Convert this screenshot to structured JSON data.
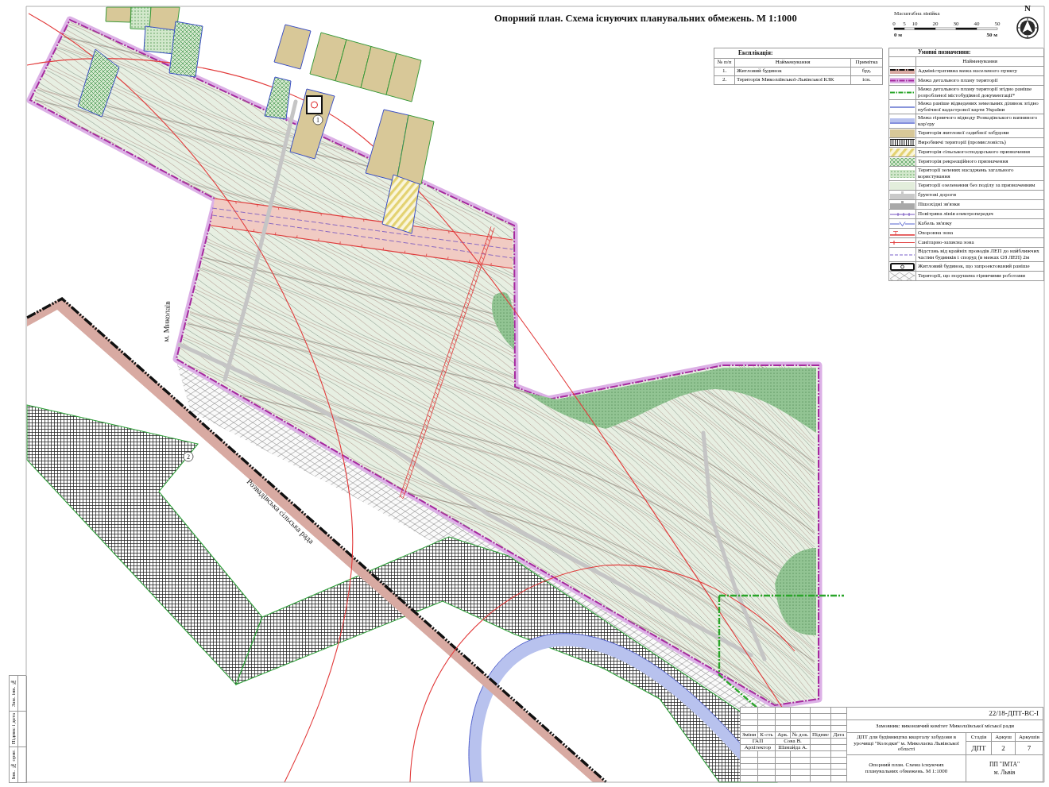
{
  "title": "Опорний план. Схема існуючих планувальних обмежень. М 1:1000",
  "scale_bar": {
    "label": "Масштабна лінійка",
    "ticks": [
      "0",
      "5",
      "10",
      "20",
      "30",
      "40",
      "50"
    ],
    "start_label": "0 м",
    "end_label": "50 м"
  },
  "compass": {
    "north": "N"
  },
  "explication": {
    "title": "Експлікація:",
    "columns": [
      "№ п/п",
      "Найменування",
      "Примітка"
    ],
    "rows": [
      {
        "number": "1.",
        "name": "Житловий будинок",
        "note": "буд."
      },
      {
        "number": "2.",
        "name": "Територія Миколаївської-Львівської КЗК",
        "note": "існ."
      }
    ]
  },
  "legend": {
    "title": "Умовні позначення:",
    "column": "Найменування",
    "items": [
      {
        "kind": "admin_boundary",
        "label": "Адміністративна межа населеного пункту"
      },
      {
        "kind": "plan_boundary",
        "label": "Межа детального плану території"
      },
      {
        "kind": "earlier_plan_boundary",
        "label": "Межа детального плану території згідно раніше розробленої містобудівної документації*"
      },
      {
        "kind": "land_plot_boundary",
        "label": "Межа раніше відведених земельних ділянок згідно публічної кадастрової карти України"
      },
      {
        "kind": "quarry_boundary",
        "label": "Межа гірничого відводу Розвадівського вапняного кар'єру"
      },
      {
        "kind": "residential",
        "label": "Територія житлової садибної забудови"
      },
      {
        "kind": "industrial",
        "label": "Виробничі території (промисловість)"
      },
      {
        "kind": "agricultural",
        "label": "Територія сільськогосподарського призначення"
      },
      {
        "kind": "recreation",
        "label": "Територія рекреаційного призначення"
      },
      {
        "kind": "public_greenery",
        "label": "Території зелених насаджень загального користування"
      },
      {
        "kind": "greenery",
        "label": "Території озеленення без поділу за призначенням"
      },
      {
        "kind": "dirt_road",
        "label": "Ґрунтові дороги"
      },
      {
        "kind": "footpath",
        "label": "Пішохідні зв'язки"
      },
      {
        "kind": "power_line",
        "label": "Повітряна лінія електропередач"
      },
      {
        "kind": "cable",
        "label": "Кабель зв'язку"
      },
      {
        "kind": "protection_zone",
        "label": "Охоронна зона"
      },
      {
        "kind": "sanitary_zone",
        "label": "Санітарно-захисна зона"
      },
      {
        "kind": "distance_line",
        "label": "Відстань від крайніх проводів ЛЕП до найближчих частин будинків і споруд (в межах ОЗ ЛЕП) 2м"
      },
      {
        "kind": "house",
        "label": "Житловий будинок, що запроектований раніше"
      },
      {
        "kind": "disturbed_land",
        "label": "Території, що порушена гірничими роботами"
      }
    ]
  },
  "map": {
    "place_labels": [
      {
        "kind": "town",
        "text": "м. Миколаїв"
      },
      {
        "kind": "council",
        "text": "Розвадівська сільська рада"
      }
    ],
    "markers": [
      "1",
      "2"
    ]
  },
  "title_block": {
    "code": "22/18-ДПТ-ВС-І",
    "customer": "Замовник: виконавчий комітет Миколаївської міської ради",
    "change_columns": [
      "Зміни",
      "К-сть",
      "Арк.",
      "№ док.",
      "Підпис",
      "Дата"
    ],
    "signatures": [
      {
        "role": "ГАП",
        "name": "Сова В."
      },
      {
        "role": "Архітектор",
        "name": "Шамайда А."
      }
    ],
    "project": "ДПТ для будівництва кварталу забудови в урочищі \"Колодки\" м. Миколаєва Львівської області",
    "stage_columns": [
      "Стадія",
      "Аркуш",
      "Аркушів"
    ],
    "stage_values": [
      "ДПТ",
      "2",
      "7"
    ],
    "sheet_title": "Опорний план. Схема існуючих планувальних обмежень. М 1:1000",
    "company": "ПП \"ІМТА\"",
    "city": "м. Львів"
  },
  "side_stamp": [
    "Зам. інв. №",
    "Підпис і дата",
    "Інв. № ориг."
  ]
}
